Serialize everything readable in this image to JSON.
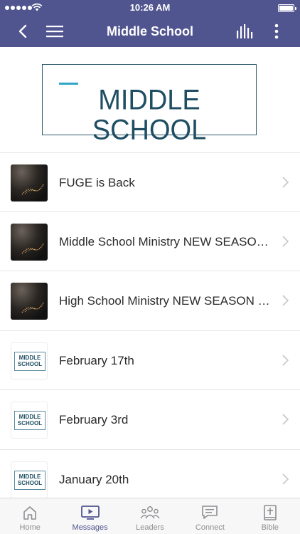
{
  "status_bar": {
    "time": "10:26 AM"
  },
  "nav": {
    "title": "Middle School"
  },
  "banner": {
    "logo_text": "MIDDLE SCHOOL"
  },
  "messages": [
    {
      "title": "FUGE is Back",
      "thumb": "dark-sparkler"
    },
    {
      "title": "Middle School Ministry NEW SEASON...",
      "thumb": "dark-sparkler"
    },
    {
      "title": "High School Ministry NEW SEASON In...",
      "thumb": "dark-sparkler"
    },
    {
      "title": "February 17th",
      "thumb": "middle-school-logo",
      "thumb_text": "MIDDLE\nSCHOOL"
    },
    {
      "title": "February 3rd",
      "thumb": "middle-school-logo",
      "thumb_text": "MIDDLE\nSCHOOL"
    },
    {
      "title": "January 20th",
      "thumb": "middle-school-logo",
      "thumb_text": "MIDDLE\nSCHOOL"
    }
  ],
  "tabs": [
    {
      "label": "Home",
      "icon": "home-icon",
      "active": false
    },
    {
      "label": "Messages",
      "icon": "tv-play-icon",
      "active": true
    },
    {
      "label": "Leaders",
      "icon": "people-icon",
      "active": false
    },
    {
      "label": "Connect",
      "icon": "chat-icon",
      "active": false
    },
    {
      "label": "Bible",
      "icon": "bible-icon",
      "active": false
    }
  ],
  "colors": {
    "header": "#50548f",
    "active_tab": "#50548f",
    "inactive_tab": "#8e8e93",
    "logo": "#1f4e63",
    "logo_accent": "#2ea7c8"
  }
}
